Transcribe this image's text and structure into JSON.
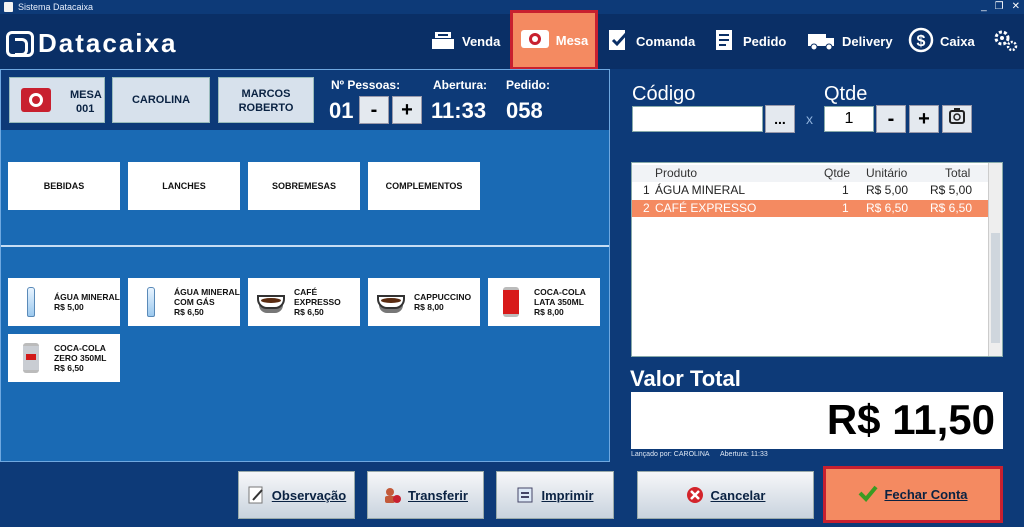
{
  "window": {
    "title": "Sistema Datacaixa",
    "controls": [
      "_",
      "❐",
      "✕"
    ]
  },
  "brand": {
    "name": "Datacaixa"
  },
  "nav": {
    "venda": "Venda",
    "mesa": "Mesa",
    "comanda": "Comanda",
    "pedido": "Pedido",
    "delivery": "Delivery",
    "caixa": "Caixa",
    "settings_icon": "gear-icon"
  },
  "info": {
    "mesa_label": "MESA",
    "mesa_num": "001",
    "waiter": "CAROLINA",
    "customer_line1": "MARCOS",
    "customer_line2": "ROBERTO",
    "pessoas_label": "Nº Pessoas:",
    "pessoas_val": "01",
    "abertura_label": "Abertura:",
    "abertura_val": "11:33",
    "pedido_label": "Pedido:",
    "pedido_val": "058",
    "minus": "-",
    "plus": "+"
  },
  "categories": [
    "BEBIDAS",
    "LANCHES",
    "SOBREMESAS",
    "COMPLEMENTOS"
  ],
  "products": [
    {
      "name1": "ÁGUA MINERAL",
      "name2": "",
      "price": "R$ 5,00",
      "icon": "bottle"
    },
    {
      "name1": "ÁGUA MINERAL",
      "name2": "COM GÁS",
      "price": "R$ 6,50",
      "icon": "bottle"
    },
    {
      "name1": "CAFÉ EXPRESSO",
      "name2": "",
      "price": "R$ 6,50",
      "icon": "cup"
    },
    {
      "name1": "CAPPUCCINO",
      "name2": "",
      "price": "R$ 8,00",
      "icon": "cup"
    },
    {
      "name1": "COCA-COLA",
      "name2": "LATA 350ML",
      "price": "R$ 8,00",
      "icon": "can"
    },
    {
      "name1": "COCA-COLA",
      "name2": "ZERO 350ML",
      "price": "R$ 6,50",
      "icon": "can-zero"
    }
  ],
  "entry": {
    "codigo_label": "Código",
    "codigo_value": "",
    "lookup": "...",
    "x": "x",
    "qtde_label": "Qtde",
    "qtde_value": "1",
    "minus": "-",
    "plus": "+"
  },
  "grid": {
    "headers": [
      "Produto",
      "Qtde",
      "Unitário",
      "Total"
    ],
    "rows": [
      {
        "n": "1",
        "produto": "ÁGUA MINERAL",
        "qtde": "1",
        "unit": "R$ 5,00",
        "total": "R$ 5,00"
      },
      {
        "n": "2",
        "produto": "CAFÉ EXPRESSO",
        "qtde": "1",
        "unit": "R$ 6,50",
        "total": "R$ 6,50"
      }
    ]
  },
  "total": {
    "label": "Valor Total",
    "value": "R$ 11,50",
    "lancado": "Lançado por: CAROLINA",
    "abertura": "Abertura: 11:33"
  },
  "actions": {
    "observacao": "Observação",
    "transferir": "Transferir",
    "imprimir": "Imprimir",
    "cancelar": "Cancelar",
    "fechar": "Fechar Conta"
  },
  "colors": {
    "accent": "#f48a61",
    "navy": "#0d3a78",
    "panel": "#1a6ab4",
    "highlight_border": "#c8202f"
  }
}
